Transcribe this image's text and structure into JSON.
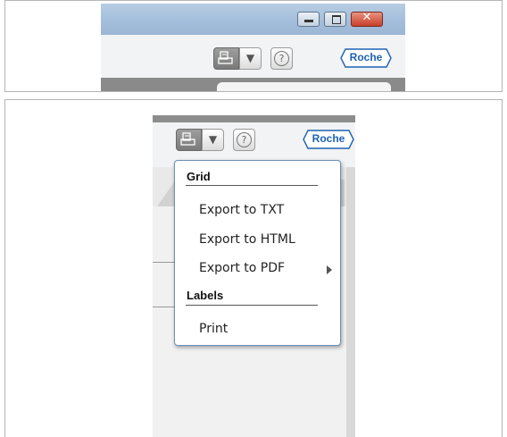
{
  "toolbar": {
    "dropdown_glyph": "▼",
    "help_glyph": "?",
    "brand": "Roche",
    "brand_color": "#1d62b3",
    "icons": [
      "print-icon",
      "dropdown-arrow-icon",
      "help-icon",
      "roche-logo"
    ]
  },
  "window_controls": {
    "close_glyph": "✕"
  },
  "menu": {
    "sections": [
      {
        "header": "Grid",
        "items": [
          "Export to TXT",
          "Export to HTML",
          "Export to PDF"
        ]
      },
      {
        "header": "Labels",
        "items": [
          "Print"
        ]
      }
    ],
    "submenu_item": "Export to PDF"
  }
}
